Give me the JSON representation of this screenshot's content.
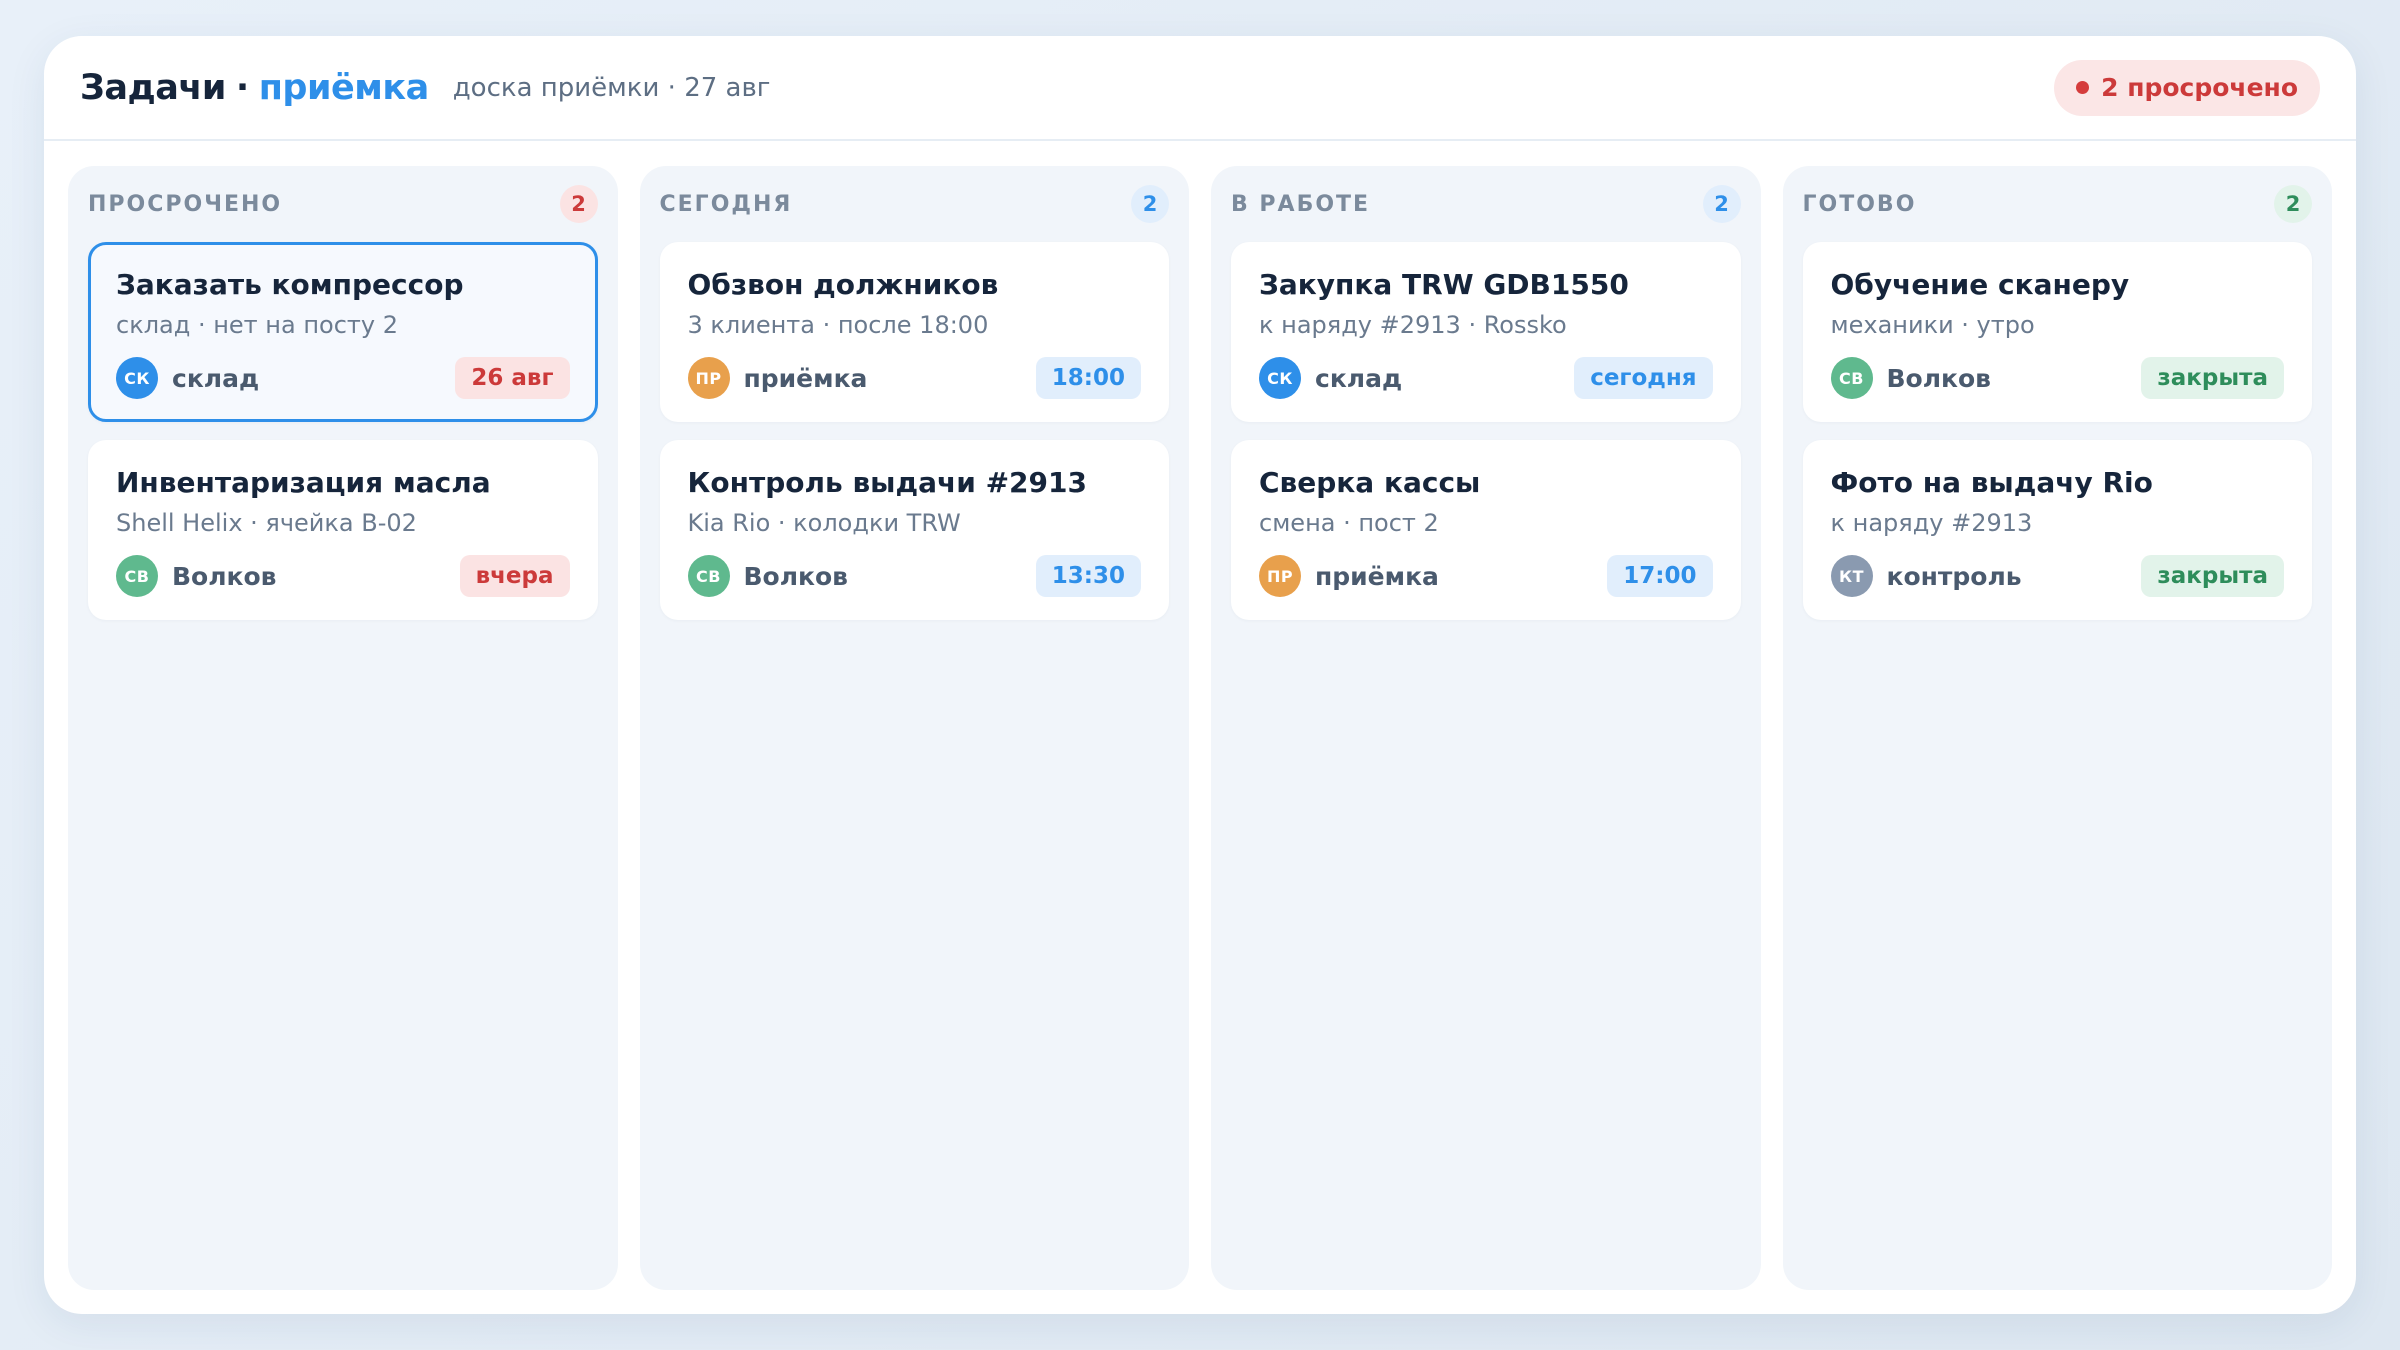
{
  "header": {
    "title": "Задачи",
    "separator": "·",
    "title_accent": "приёмка",
    "subtitle": "доска приёмки · 27 авг",
    "overdue_badge": "2 просрочено"
  },
  "colors": {
    "accent": "#2e8fe9",
    "overdue": "#cc3a3a",
    "done": "#2e8d5b"
  },
  "columns": [
    {
      "title": "ПРОСРОЧЕНО",
      "count": "2",
      "cards": [
        {
          "title": "Заказать компрессор",
          "sub": "склад · нет на посту 2",
          "avatar": "СК",
          "assignee": "склад",
          "tag": "26 авг",
          "selected": true
        },
        {
          "title": "Инвентаризация масла",
          "sub": "Shell Helix · ячейка B-02",
          "avatar": "СВ",
          "assignee": "Волков",
          "tag": "вчера"
        }
      ]
    },
    {
      "title": "СЕГОДНЯ",
      "count": "2",
      "cards": [
        {
          "title": "Обзвон должников",
          "sub": "3 клиента · после 18:00",
          "avatar": "ПР",
          "assignee": "приёмка",
          "tag": "18:00"
        },
        {
          "title": "Контроль выдачи #2913",
          "sub": "Kia Rio · колодки TRW",
          "avatar": "СВ",
          "assignee": "Волков",
          "tag": "13:30"
        }
      ]
    },
    {
      "title": "В РАБОТЕ",
      "count": "2",
      "cards": [
        {
          "title": "Закупка TRW GDB1550",
          "sub": "к наряду #2913 · Rossko",
          "avatar": "СК",
          "assignee": "склад",
          "tag": "сегодня"
        },
        {
          "title": "Сверка кассы",
          "sub": "смена · пост 2",
          "avatar": "ПР",
          "assignee": "приёмка",
          "tag": "17:00"
        }
      ]
    },
    {
      "title": "ГОТОВО",
      "count": "2",
      "cards": [
        {
          "title": "Обучение сканеру",
          "sub": "механики · утро",
          "avatar": "СВ",
          "assignee": "Волков",
          "tag": "закрыта"
        },
        {
          "title": "Фото на выдачу Rio",
          "sub": "к наряду #2913",
          "avatar": "КТ",
          "assignee": "контроль",
          "tag": "закрыта"
        }
      ]
    }
  ]
}
